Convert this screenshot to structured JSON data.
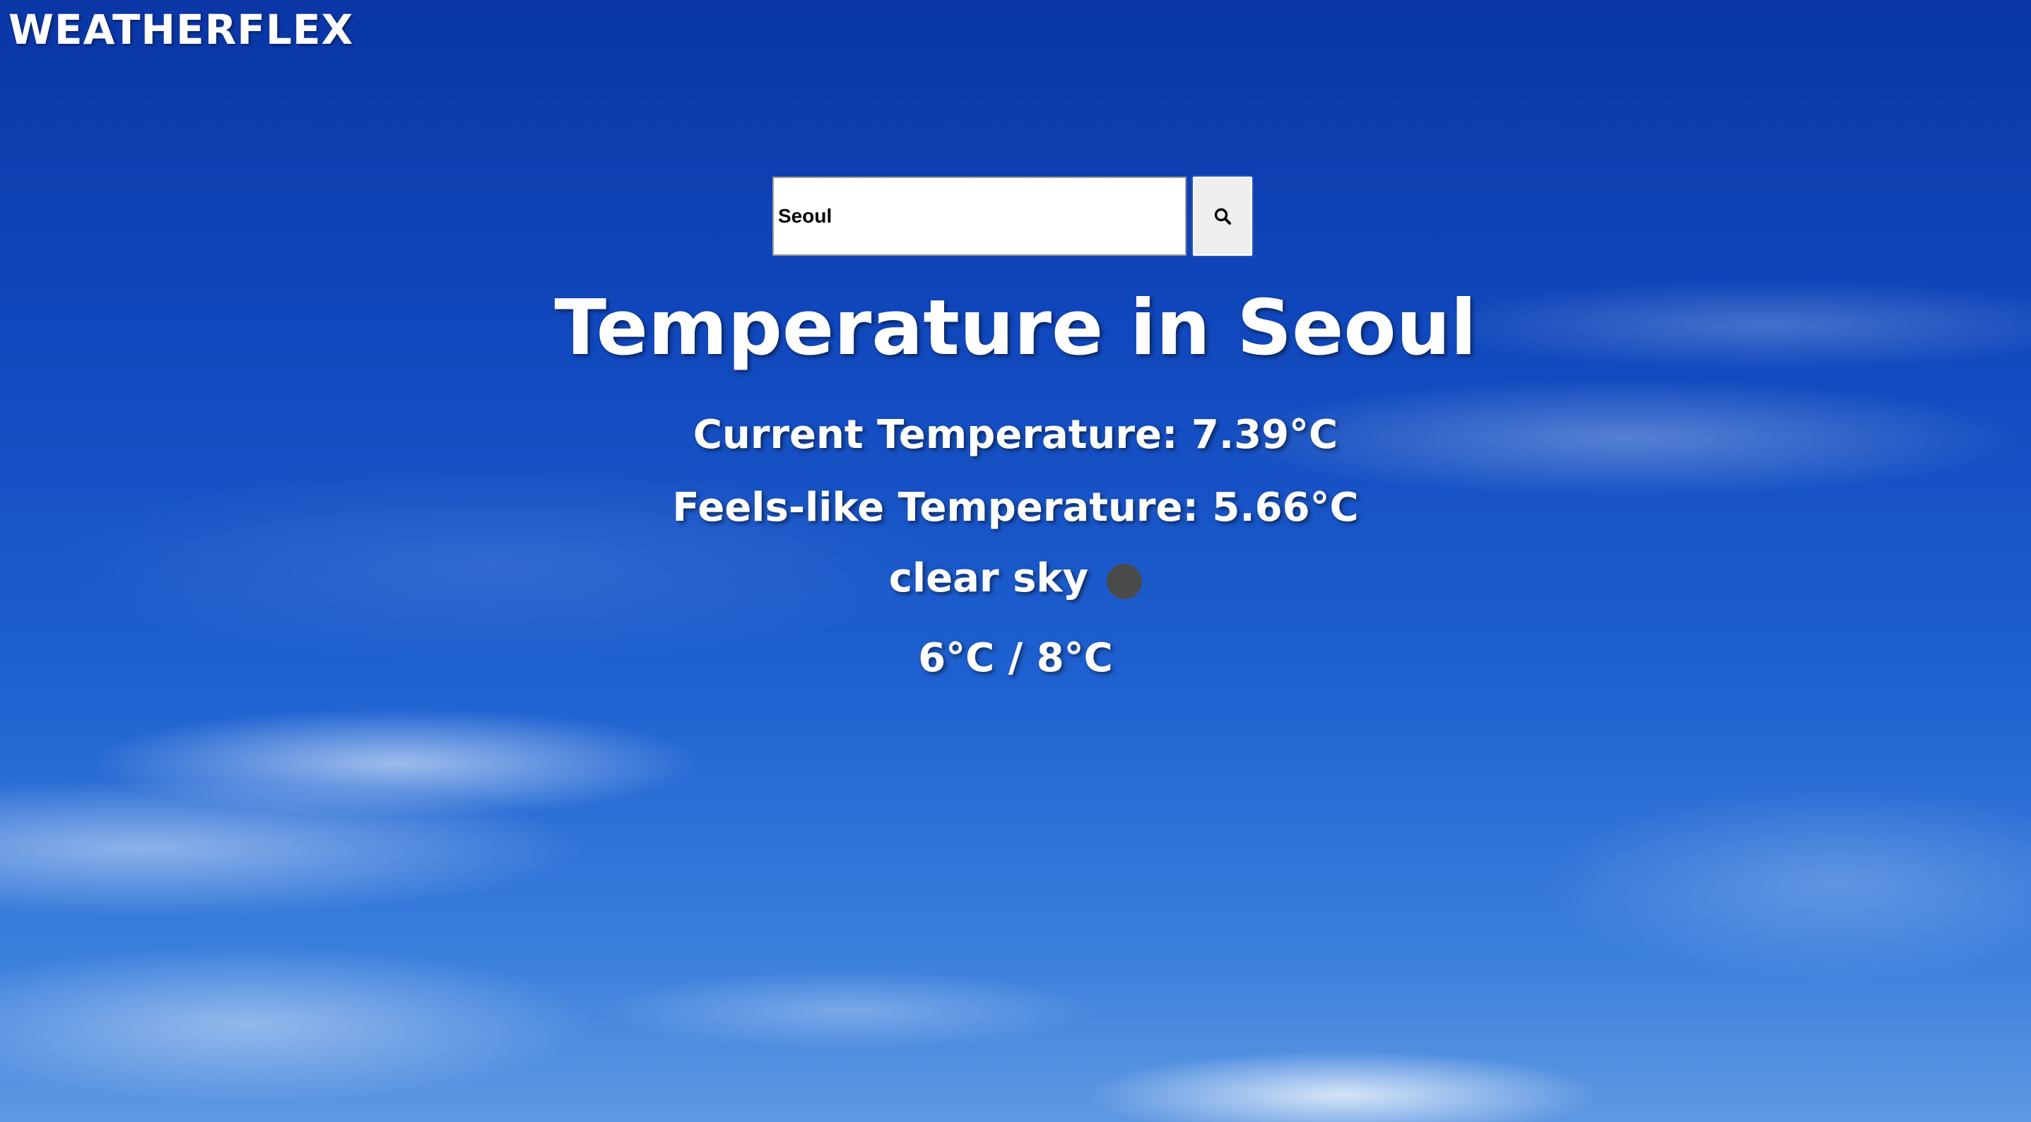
{
  "app": {
    "brand": "WEATHERFLEX"
  },
  "search": {
    "value": "Seoul",
    "button_icon": "search-icon"
  },
  "weather": {
    "title": "Temperature in Seoul",
    "current": "Current Temperature: 7.39°C",
    "feels_like": "Feels-like Temperature: 5.66°C",
    "description": "clear sky",
    "icon": "weather-condition-icon",
    "min_max": "6°C / 8°C"
  },
  "colors": {
    "sky_top": "#0a36a6",
    "sky_bottom": "#5f98e2",
    "text": "#ffffff",
    "icon_placeholder": "#4a4a4a"
  }
}
